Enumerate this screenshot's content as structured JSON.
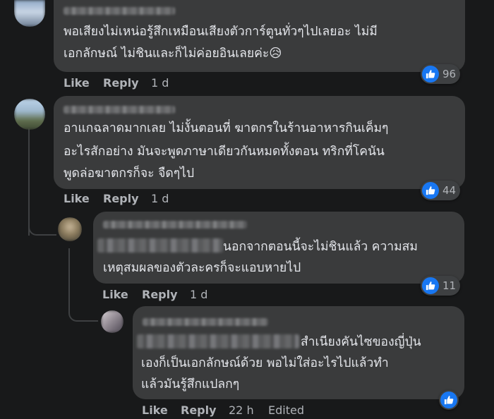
{
  "comments": [
    {
      "text_lines": [
        "พอเสียงไม่เหน่อรู้สึกเหมือนเสียงตัวการ์ตูนทั่วๆไปเลยอะ ไม่มี",
        "เอกลักษณ์ ไม่ชินและก็ไม่ค่อยอินเลยค่ะ😥"
      ],
      "like_label": "Like",
      "reply_label": "Reply",
      "time": "1 d",
      "reactions": "96"
    },
    {
      "text_lines": [
        "อาแกฉลาดมากเลย ไม่งั้นตอนที่ ฆาตกรในร้านอาหารกินเค็มๆ",
        "อะไรสักอย่าง มันจะพูดภาษาเดียวกันหมดทั้งตอน ทริกที่โคนัน",
        "พูดล่อฆาตกรก็จะ จืดๆไป"
      ],
      "like_label": "Like",
      "reply_label": "Reply",
      "time": "1 d",
      "reactions": "44"
    },
    {
      "text_lines": [
        "นอกจากตอนนี้จะไม่ชินแล้ว ความสม",
        "เหตุสมผลของตัวละครก็จะแอบหายไป"
      ],
      "like_label": "Like",
      "reply_label": "Reply",
      "time": "1 d",
      "reactions": "11"
    },
    {
      "text_lines": [
        "สำเนียงคันไซของญี่ปุ่น",
        "เองก็เป็นเอกลักษณ์ด้วย พอไม่ใส่อะไรไปแล้วทำ",
        "แล้วมันรู้สึกแปลกๆ"
      ],
      "like_label": "Like",
      "reply_label": "Reply",
      "time": "22 h",
      "edited": "Edited"
    }
  ],
  "colors": {
    "background": "#18191a",
    "bubble": "#3a3b3c",
    "text": "#e4e6eb",
    "muted": "#b0b3b8",
    "like_blue": "#1877f2"
  },
  "icons": {
    "reaction": "thumbs-up-icon"
  }
}
